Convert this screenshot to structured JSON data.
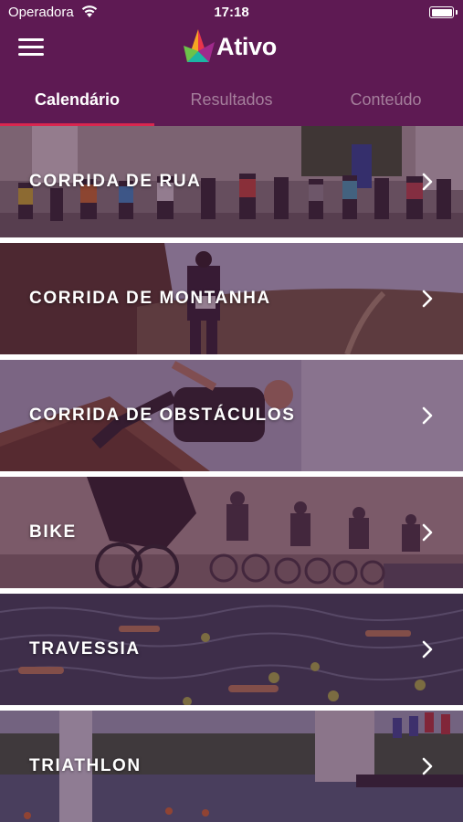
{
  "status_bar": {
    "carrier": "Operadora",
    "time": "17:18",
    "icons": [
      "wifi-icon",
      "battery-icon"
    ]
  },
  "header": {
    "menu_icon": "hamburger-menu-icon",
    "brand": "Ativo",
    "colors": {
      "bar": "#5e1a53",
      "tab_indicator": "#d9264f",
      "inactive_tab": "#a57f9c",
      "overlay": "#3f1238"
    }
  },
  "tabs": [
    {
      "label": "Calendário",
      "active": true
    },
    {
      "label": "Resultados",
      "active": false
    },
    {
      "label": "Conteúdo",
      "active": false
    }
  ],
  "categories": [
    {
      "label": "CORRIDA DE RUA",
      "icon": "chevron-right-icon",
      "photo": "road-race-runners"
    },
    {
      "label": "CORRIDA DE MONTANHA",
      "icon": "chevron-right-icon",
      "photo": "mountain-trail-runner"
    },
    {
      "label": "CORRIDA DE OBSTÁCULOS",
      "icon": "chevron-right-icon",
      "photo": "obstacle-course-jump"
    },
    {
      "label": "BIKE",
      "icon": "chevron-right-icon",
      "photo": "cyclists-race"
    },
    {
      "label": "TRAVESSIA",
      "icon": "chevron-right-icon",
      "photo": "open-water-swimmers"
    },
    {
      "label": "TRIATHLON",
      "icon": "chevron-right-icon",
      "photo": "triathlon-lake-venue"
    }
  ]
}
